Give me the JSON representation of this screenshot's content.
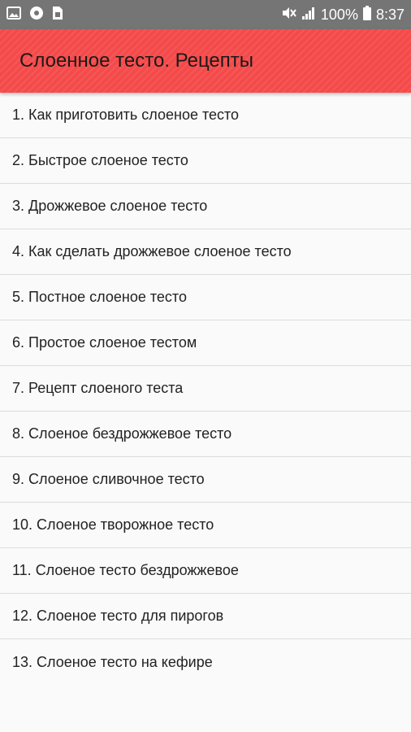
{
  "status_bar": {
    "battery_percent": "100%",
    "time": "8:37",
    "icons": [
      "image-icon",
      "circle-icon",
      "sim-icon",
      "mute-icon",
      "signal-icon",
      "battery-icon"
    ]
  },
  "app_bar": {
    "title": "Слоенное тесто. Рецепты",
    "color": "#f44a4a"
  },
  "recipes": [
    "1. Как приготовить слоеное тесто",
    "2. Быстрое слоеное тесто",
    "3. Дрожжевое слоеное тесто",
    "4. Как сделать дрожжевое слоеное тесто",
    "5. Постное слоеное тесто",
    "6. Простое слоеное тестом",
    "7. Рецепт слоеного теста",
    "8. Слоеное бездрожжевое тесто",
    "9. Слоеное сливочное тесто",
    "10. Слоеное творожное тесто",
    "11. Слоеное тесто бездрожжевое",
    "12. Слоеное тесто для пирогов",
    "13. Слоеное тесто на кефире"
  ]
}
